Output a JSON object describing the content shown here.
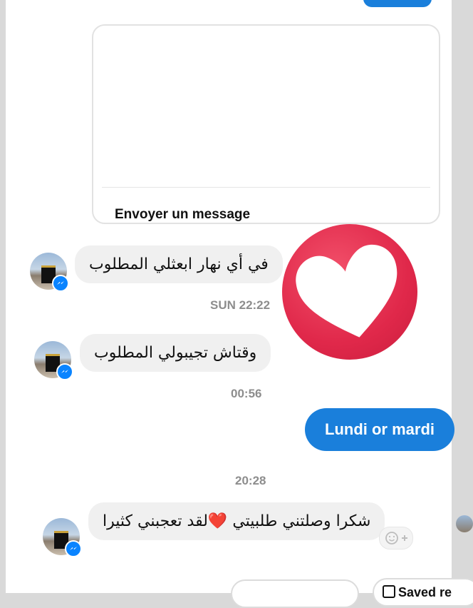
{
  "card": {
    "action_label": "Envoyer un message"
  },
  "messages": {
    "m1": "في أي  نهار ابعثلي المطلوب",
    "t1": "SUN 22:22",
    "m2": "وقتاش تجيبولي المطلوب",
    "t2": "00:56",
    "out1": "Lundi or mardi",
    "t3": "20:28",
    "m3_part1": "شكرا وصلتني طلبيتي",
    "m3_emoji": "❤️",
    "m3_part2": "لقد تعجبني كثيرا"
  },
  "reaction": {
    "icon": "heart-icon",
    "color": "#e0284a"
  },
  "bottom_bar": {
    "saved_label": "Saved re"
  },
  "colors": {
    "accent": "#1a7fdb",
    "incoming_bg": "#f0f0f0",
    "timestamp": "#8d8d8d"
  }
}
